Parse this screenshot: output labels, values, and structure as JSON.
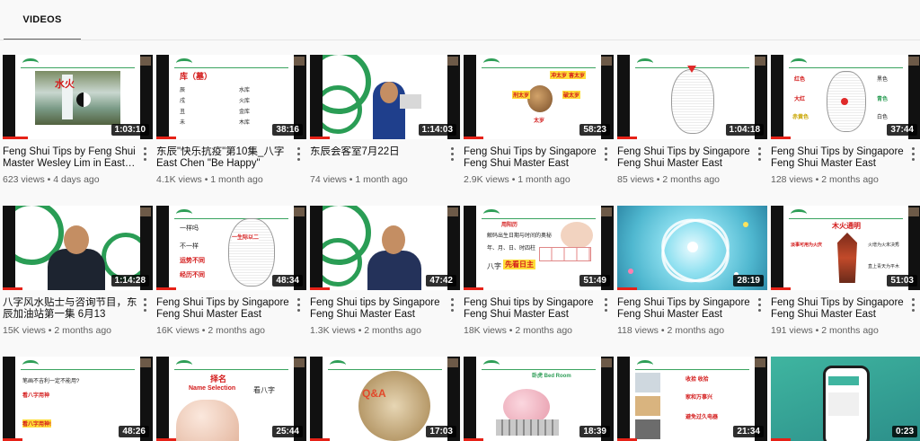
{
  "tabs": {
    "videos": "VIDEOS"
  },
  "colors": {
    "accent": "#e62117",
    "slide_green": "#2e9e57"
  },
  "videos": [
    {
      "title": "Feng Shui Tips by Feng Shui Master Wesley Lim in East…",
      "views": "623 views",
      "age": "4 days ago",
      "duration": "1:03:10",
      "slide_text": [
        "",
        ""
      ]
    },
    {
      "title": "东辰\"快乐抗疫\"第10集_八字 East Chen \"Be Happy\" Serie…",
      "views": "4.1K views",
      "age": "1 month ago",
      "duration": "38:16",
      "slide_text": [
        "库（墓）",
        "水库",
        "火库",
        "金库",
        "木库"
      ]
    },
    {
      "title": "东辰会客室7月22日",
      "views": "74 views",
      "age": "1 month ago",
      "duration": "1:14:03",
      "slide_text": []
    },
    {
      "title": "Feng Shui Tips by Singapore Feng Shui Master East Chen…",
      "views": "2.9K views",
      "age": "1 month ago",
      "duration": "58:23",
      "slide_text": [
        "冲太岁",
        "害太岁",
        "刑太岁",
        "破太岁",
        "太岁"
      ]
    },
    {
      "title": "Feng Shui Tips by Singapore Feng Shui Master East Chen…",
      "views": "85 views",
      "age": "2 months ago",
      "duration": "1:04:18",
      "slide_text": []
    },
    {
      "title": "Feng Shui Tips by Singapore Feng Shui Master East Chen…",
      "views": "128 views",
      "age": "2 months ago",
      "duration": "37:44",
      "slide_text": [
        "红色",
        "黑色",
        "大红",
        "青色",
        "赤黄色",
        "白色"
      ]
    },
    {
      "title": "八字风水贴士与咨询节目，东辰加油站第一集 6月13",
      "views": "15K views",
      "age": "2 months ago",
      "duration": "1:14:28",
      "slide_text": []
    },
    {
      "title": "Feng Shui Tips by Singapore Feng Shui Master East Chen…",
      "views": "16K views",
      "age": "2 months ago",
      "duration": "48:34",
      "slide_text": [
        "一样吗",
        "不一样",
        "运势不同",
        "经历不同",
        "一生际以二"
      ]
    },
    {
      "title": "Feng Shui tips by Singapore Feng Shui Master East Chen…",
      "views": "1.3K views",
      "age": "2 months ago",
      "duration": "47:42",
      "slide_text": []
    },
    {
      "title": "Feng Shui tips by Singapore Feng Shui Master East Chen…",
      "views": "18K views",
      "age": "2 months ago",
      "duration": "51:49",
      "slide_text": [
        "用阳历",
        "解码出生日期与时间的奥秘",
        "年、月、日、时四柱",
        "八字",
        "先看日主"
      ]
    },
    {
      "title": "Feng Shui Tips by Singapore Feng Shui Master East Chen…",
      "views": "118 views",
      "age": "2 months ago",
      "duration": "28:19",
      "slide_text": []
    },
    {
      "title": "Feng Shui Tips by Singapore Feng Shui Master East Chen…",
      "views": "191 views",
      "age": "2 months ago",
      "duration": "51:03",
      "slide_text": [
        "木火通明",
        "淡事可用为火庆",
        "火增为火未决秀",
        "直上青天为平木"
      ]
    },
    {
      "title": "",
      "views": "",
      "age": "",
      "duration": "48:26",
      "slide_text": [
        "笔画不吉利一定不能用?",
        "看八字用神",
        "看八字用神!"
      ]
    },
    {
      "title": "",
      "views": "",
      "age": "",
      "duration": "25:44",
      "slide_text": [
        "择名",
        "Name Selection",
        "看八字"
      ]
    },
    {
      "title": "",
      "views": "",
      "age": "",
      "duration": "17:03",
      "slide_text": [
        "Q&A"
      ]
    },
    {
      "title": "",
      "views": "",
      "age": "",
      "duration": "18:39",
      "slide_text": [
        "卧虎 Bed Room"
      ]
    },
    {
      "title": "",
      "views": "",
      "age": "",
      "duration": "21:34",
      "slide_text": [
        "收拾 收拾",
        "家和万事兴",
        "避免过久电器"
      ]
    },
    {
      "title": "",
      "views": "",
      "age": "",
      "duration": "0:23",
      "slide_text": []
    }
  ]
}
